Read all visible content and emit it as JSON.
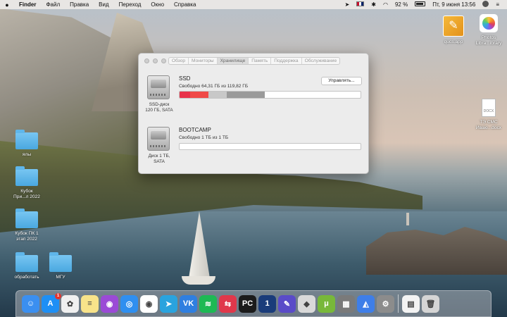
{
  "menubar": {
    "apple_icon": "apple-icon",
    "items": [
      "Finder",
      "Файл",
      "Правка",
      "Вид",
      "Переход",
      "Окно",
      "Справка"
    ],
    "status": {
      "battery_pct": "92 %",
      "battery_level": 0.92,
      "datetime": "Пт, 9 июня 13:56"
    }
  },
  "window": {
    "tabs": [
      "Обзор",
      "Мониторы",
      "Хранилище",
      "Память",
      "Поддержка",
      "Обслуживание"
    ],
    "active_tab": "Хранилище",
    "disks": [
      {
        "name": "SSD",
        "free_text": "Свободно 64,31 ГБ из 119,82 ГБ",
        "caption_line1": "SSD-диск",
        "caption_line2": "120 ГБ, SATA",
        "manage_label": "Управлять...",
        "usage_segments": [
          {
            "fraction": 0.06,
            "color": "#e8324a"
          },
          {
            "fraction": 0.1,
            "color": "#f04a48"
          },
          {
            "fraction": 0.1,
            "color": "#c8c8c8"
          },
          {
            "fraction": 0.21,
            "color": "#9a9a9a"
          }
        ]
      },
      {
        "name": "BOOTCAMP",
        "free_text": "Свободно 1 ТБ из 1 ТБ",
        "caption_line1": "Диск 1 ТБ,",
        "caption_line2": "SATA"
      }
    ]
  },
  "desktop": {
    "folders": [
      {
        "label1": "ялы",
        "label2": ""
      },
      {
        "label1": "Кубок",
        "label2": "При...л 2022"
      },
      {
        "label1": "Кубок ПК 1",
        "label2": "этап 2022"
      },
      {
        "label1": "обработать",
        "label2": ""
      },
      {
        "label1": "МГУ",
        "label2": ""
      }
    ],
    "right_icons": [
      {
        "label1": "qucs.app",
        "label2": ""
      },
      {
        "label1": "Photos",
        "label2": "Libra...ibrary"
      },
      {
        "label1": "ТЭ СМС",
        "label2": "Иваю...docx",
        "doc_tag": "DOCX"
      }
    ]
  },
  "dock": {
    "apps": [
      {
        "name": "finder-icon",
        "color": "#3b8ff0",
        "glyph": "☺"
      },
      {
        "name": "app-store-icon",
        "color": "#1e8ff5",
        "glyph": "A",
        "badge": "1"
      },
      {
        "name": "photos-icon",
        "color": "#f0f0f0",
        "glyph": "✿"
      },
      {
        "name": "notes-icon",
        "color": "#f8e38a",
        "glyph": "≡"
      },
      {
        "name": "podcasts-icon",
        "color": "#9b4ad6",
        "glyph": "◉"
      },
      {
        "name": "safari-icon",
        "color": "#2f8ff0",
        "glyph": "◎"
      },
      {
        "name": "chrome-icon",
        "color": "#ffffff",
        "glyph": "◉"
      },
      {
        "name": "telegram-icon",
        "color": "#2aa3de",
        "glyph": "➤"
      },
      {
        "name": "vk-icon",
        "color": "#2f7fe0",
        "glyph": "VK"
      },
      {
        "name": "spotify-icon",
        "color": "#1db954",
        "glyph": "≋"
      },
      {
        "name": "tableplus-icon",
        "color": "#e0384b",
        "glyph": "⇆"
      },
      {
        "name": "pycharm-icon",
        "color": "#1b1b1b",
        "glyph": "PC"
      },
      {
        "name": "1password-icon",
        "color": "#1a3c7a",
        "glyph": "1"
      },
      {
        "name": "pixelmator-icon",
        "color": "#5a4bc8",
        "glyph": "✎"
      },
      {
        "name": "fox-icon",
        "color": "#d9d9d9",
        "glyph": "◆"
      },
      {
        "name": "utorrent-icon",
        "color": "#78b83a",
        "glyph": "μ"
      },
      {
        "name": "calculator-icon",
        "color": "#7a7a7a",
        "glyph": "▦"
      },
      {
        "name": "nordvpn-icon",
        "color": "#3e7ee8",
        "glyph": "◭"
      },
      {
        "name": "system-preferences-icon",
        "color": "#8c8c8c",
        "glyph": "⚙"
      },
      {
        "name": "docx-file-icon",
        "color": "#f3f3f3",
        "glyph": "▤"
      },
      {
        "name": "trash-icon",
        "color": "#d5d5d5",
        "glyph": "🗑"
      }
    ]
  }
}
